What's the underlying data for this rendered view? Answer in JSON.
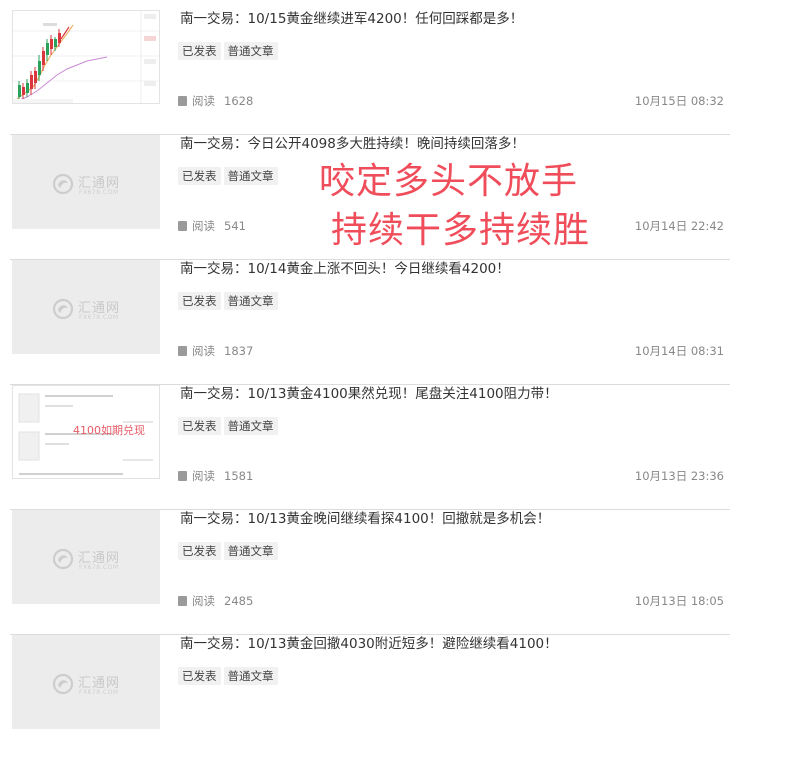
{
  "articles": [
    {
      "thumb_type": "chart",
      "title": "南一交易：10/15黄金继续进军4200！任何回踩都是多！",
      "tags": [
        "已发表",
        "普通文章"
      ],
      "reads_label": "阅读",
      "reads": "1628",
      "date": "10月15日 08:32"
    },
    {
      "thumb_type": "placeholder",
      "title": "南一交易：今日公开4098多大胜持续！晚间持续回落多！",
      "tags": [
        "已发表",
        "普通文章"
      ],
      "reads_label": "阅读",
      "reads": "541",
      "date": "10月14日 22:42"
    },
    {
      "thumb_type": "placeholder",
      "title": "南一交易：10/14黄金上涨不回头！今日继续看4200！",
      "tags": [
        "已发表",
        "普通文章"
      ],
      "reads_label": "阅读",
      "reads": "1837",
      "date": "10月14日 08:31"
    },
    {
      "thumb_type": "document",
      "title": "南一交易：10/13黄金4100果然兑现！尾盘关注4100阻力带！",
      "tags": [
        "已发表",
        "普通文章"
      ],
      "reads_label": "阅读",
      "reads": "1581",
      "date": "10月13日 23:36"
    },
    {
      "thumb_type": "placeholder",
      "title": "南一交易：10/13黄金晚间继续看探4100！回撤就是多机会！",
      "tags": [
        "已发表",
        "普通文章"
      ],
      "reads_label": "阅读",
      "reads": "2485",
      "date": "10月13日 18:05"
    },
    {
      "thumb_type": "placeholder",
      "title": "南一交易：10/13黄金回撤4030附近短多！避险继续看4100！",
      "tags": [
        "已发表",
        "普通文章"
      ],
      "reads_label": "阅读",
      "reads": "",
      "date": ""
    }
  ],
  "placeholder_logo": {
    "name": "汇通网",
    "sub": "FX678.COM"
  },
  "overlay": {
    "line1": "咬定多头不放手",
    "line2": "持续干多持续胜",
    "color": "#f04d5b"
  },
  "document_thumb_stamp": "4100如期兑现"
}
